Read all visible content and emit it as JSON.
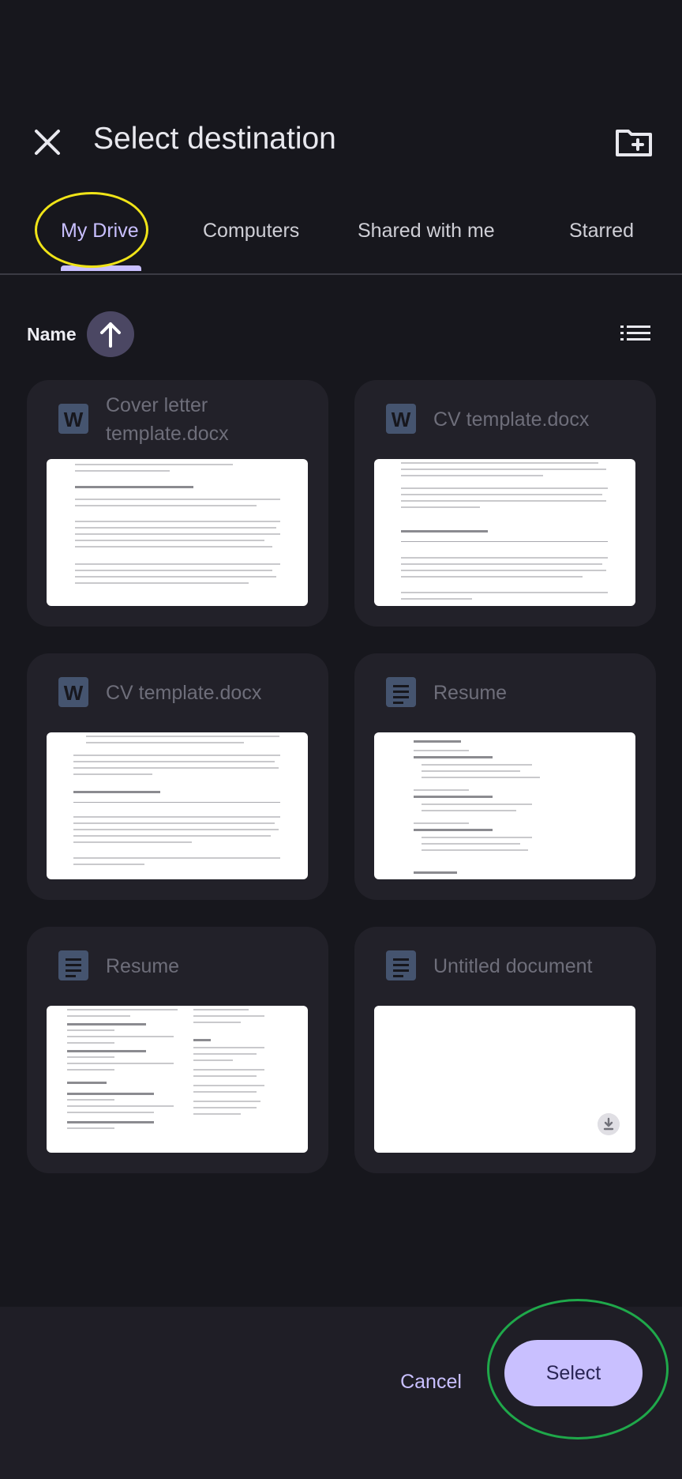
{
  "header": {
    "title": "Select destination"
  },
  "tabs": [
    {
      "label": "My Drive",
      "active": true
    },
    {
      "label": "Computers",
      "active": false
    },
    {
      "label": "Shared with me",
      "active": false
    },
    {
      "label": "Starred",
      "active": false
    }
  ],
  "sort": {
    "label": "Name",
    "direction_icon": "arrow-up-icon",
    "view_icon": "list-view-icon"
  },
  "files": [
    {
      "name": "Cover letter template.docx",
      "type_icon": "word-doc-icon"
    },
    {
      "name": "CV template.docx",
      "type_icon": "word-doc-icon"
    },
    {
      "name": "CV template.docx",
      "type_icon": "word-doc-icon"
    },
    {
      "name": "Resume",
      "type_icon": "google-doc-icon"
    },
    {
      "name": "Resume",
      "type_icon": "google-doc-icon"
    },
    {
      "name": "Untitled document",
      "type_icon": "google-doc-icon"
    }
  ],
  "footer": {
    "cancel_label": "Cancel",
    "select_label": "Select"
  },
  "colors": {
    "accent": "#c9c0ff",
    "background": "#17171d",
    "card": "#222129",
    "annotation_yellow": "#f0e418",
    "annotation_green": "#1fa84a"
  }
}
